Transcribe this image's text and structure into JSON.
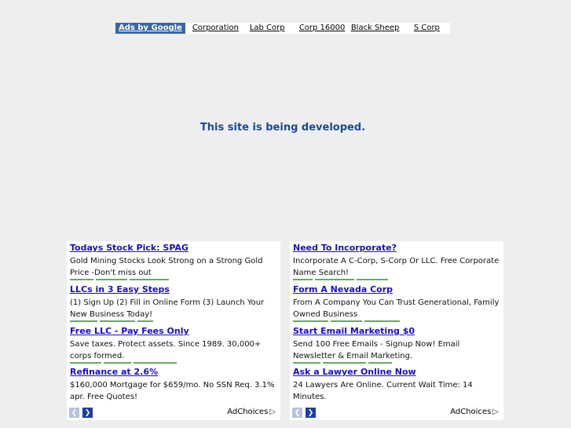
{
  "linkbar": {
    "ads_label": "Ads by Google",
    "links": [
      "Corporation",
      "Lab Corp",
      "Corp 16000",
      "Black Sheep",
      "S Corp"
    ]
  },
  "main": {
    "message": "This site is being developed."
  },
  "ad_left": {
    "ads": [
      {
        "title": "Todays Stock Pick: SPAG",
        "desc": "Gold Mining Stocks Look Strong on a Strong Gold Price -Don't miss out"
      },
      {
        "title": "LLCs in 3 Easy Steps",
        "desc": "(1) Sign Up (2) Fill in Online Form (3) Launch Your New Business Today!"
      },
      {
        "title": "Free LLC - Pay Fees Only",
        "desc": "Save taxes. Protect assets. Since 1989. 30,000+ corps formed."
      },
      {
        "title": "Refinance at 2.6%",
        "desc": "$160,000 Mortgage for $659/mo. No SSN Req. 3.1% apr. Free Quotes!"
      }
    ],
    "prev_icon": "chevron-left-icon",
    "next_icon": "chevron-right-icon",
    "adchoices": "AdChoices"
  },
  "ad_right": {
    "ads": [
      {
        "title": "Need To Incorporate?",
        "desc": "Incorporate A C-Corp, S-Corp Or LLC. Free Corporate Name Search!"
      },
      {
        "title": "Form A Nevada Corp",
        "desc": "From A Company You Can Trust Generational, Family Owned Business"
      },
      {
        "title": "Start Email Marketing $0",
        "desc": "Send 100 Free Emails - Signup Now! Email Newsletter & Email Marketing."
      },
      {
        "title": "Ask a Lawyer Online Now",
        "desc": "24 Lawyers Are Online. Current Wait Time: 14 Minutes."
      }
    ],
    "prev_icon": "chevron-left-icon",
    "next_icon": "chevron-right-icon",
    "adchoices": "AdChoices"
  },
  "colors": {
    "background": "#eceef0",
    "ads_badge": "#3867a8",
    "ad_title": "#1a0dcc",
    "message": "#1e4b8a"
  }
}
